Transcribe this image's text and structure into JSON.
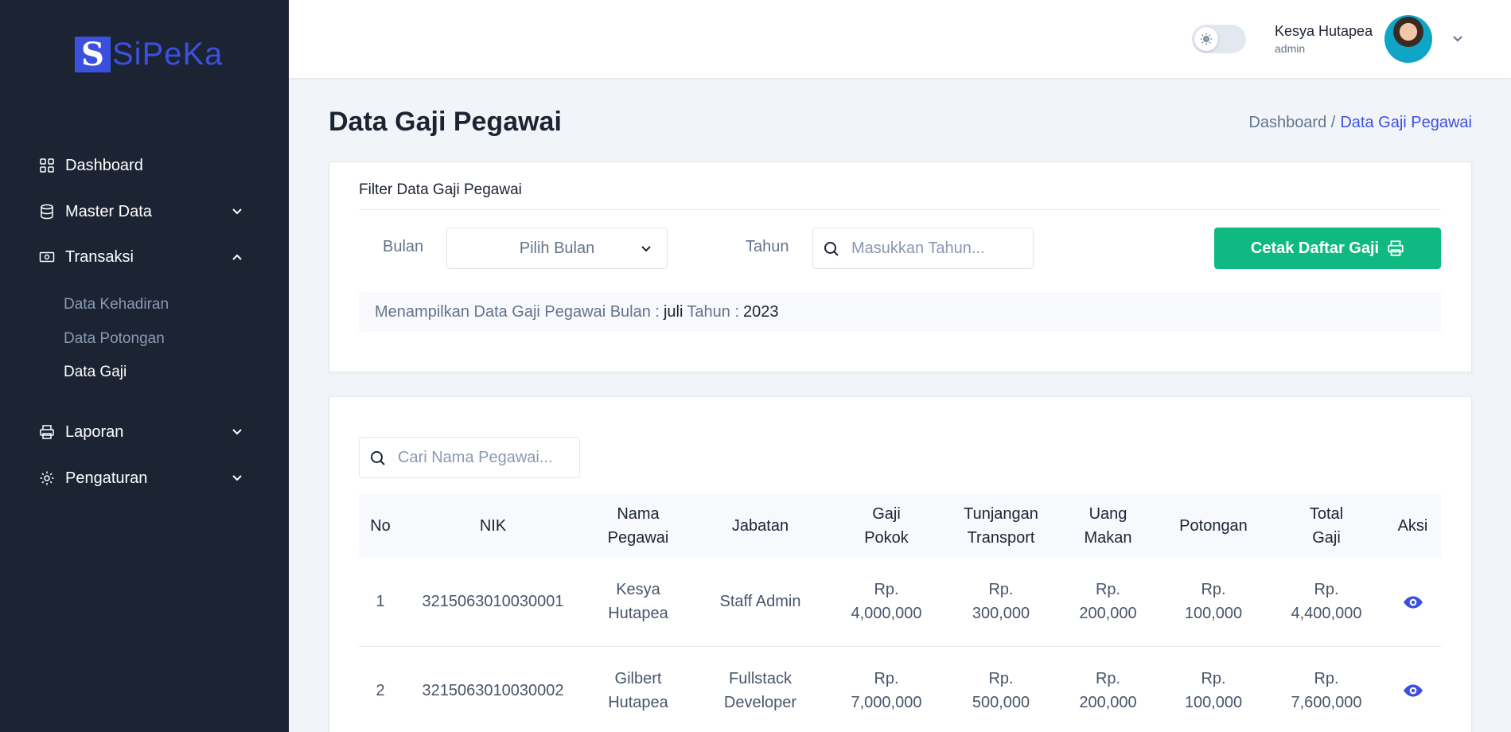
{
  "app": {
    "logo_letter": "S",
    "logo_text": "SiPeKa"
  },
  "sidebar": {
    "items": [
      {
        "label": "Dashboard",
        "icon": "grid-icon"
      },
      {
        "label": "Master Data",
        "icon": "database-icon",
        "expanded": false
      },
      {
        "label": "Transaksi",
        "icon": "money-icon",
        "expanded": true
      },
      {
        "label": "Laporan",
        "icon": "printer-icon",
        "expanded": false
      },
      {
        "label": "Pengaturan",
        "icon": "gear-icon",
        "expanded": false
      }
    ],
    "sub_items": [
      {
        "label": "Data Kehadiran",
        "active": false
      },
      {
        "label": "Data Potongan",
        "active": false
      },
      {
        "label": "Data Gaji",
        "active": true
      }
    ]
  },
  "header": {
    "theme_toggle": "light",
    "user_name": "Kesya Hutapea",
    "user_role": "admin"
  },
  "page": {
    "title": "Data Gaji Pegawai",
    "breadcrumb": [
      "Dashboard /",
      "Data Gaji Pegawai"
    ]
  },
  "filter": {
    "title": "Filter Data Gaji Pegawai",
    "month_label": "Bulan",
    "month_value": "Pilih Bulan",
    "year_label": "Tahun",
    "year_placeholder": "Masukkan Tahun...",
    "print_button": "Cetak Daftar Gaji",
    "info_prefix": "Menampilkan Data Gaji Pegawai Bulan :",
    "info_month": "juli",
    "info_mid": "Tahun :",
    "info_year": "2023"
  },
  "table": {
    "search_placeholder": "Cari Nama Pegawai...",
    "headers": [
      [
        "No"
      ],
      [
        "NIK"
      ],
      [
        "Nama",
        "Pegawai"
      ],
      [
        "Jabatan"
      ],
      [
        "Gaji",
        "Pokok"
      ],
      [
        "Tunjangan",
        "Transport"
      ],
      [
        "Uang",
        "Makan"
      ],
      [
        "Potongan"
      ],
      [
        "Total",
        "Gaji"
      ],
      [
        "Aksi"
      ]
    ],
    "rows": [
      {
        "no": "1",
        "nik": "3215063010030001",
        "nama": [
          "Kesya",
          "Hutapea"
        ],
        "jabatan": [
          "Staff Admin"
        ],
        "gaji_pokok": [
          "Rp.",
          "4,000,000"
        ],
        "tunjangan": [
          "Rp.",
          "300,000"
        ],
        "uang_makan": [
          "Rp.",
          "200,000"
        ],
        "potongan": [
          "Rp.",
          "100,000"
        ],
        "total": [
          "Rp.",
          "4,400,000"
        ]
      },
      {
        "no": "2",
        "nik": "3215063010030002",
        "nama": [
          "Gilbert",
          "Hutapea"
        ],
        "jabatan": [
          "Fullstack",
          "Developer"
        ],
        "gaji_pokok": [
          "Rp.",
          "7,000,000"
        ],
        "tunjangan": [
          "Rp.",
          "500,000"
        ],
        "uang_makan": [
          "Rp.",
          "200,000"
        ],
        "potongan": [
          "Rp.",
          "100,000"
        ],
        "total": [
          "Rp.",
          "7,600,000"
        ]
      }
    ]
  },
  "colors": {
    "sidebar": "#1c2434",
    "primary": "#3c50e0",
    "success": "#10b981"
  }
}
